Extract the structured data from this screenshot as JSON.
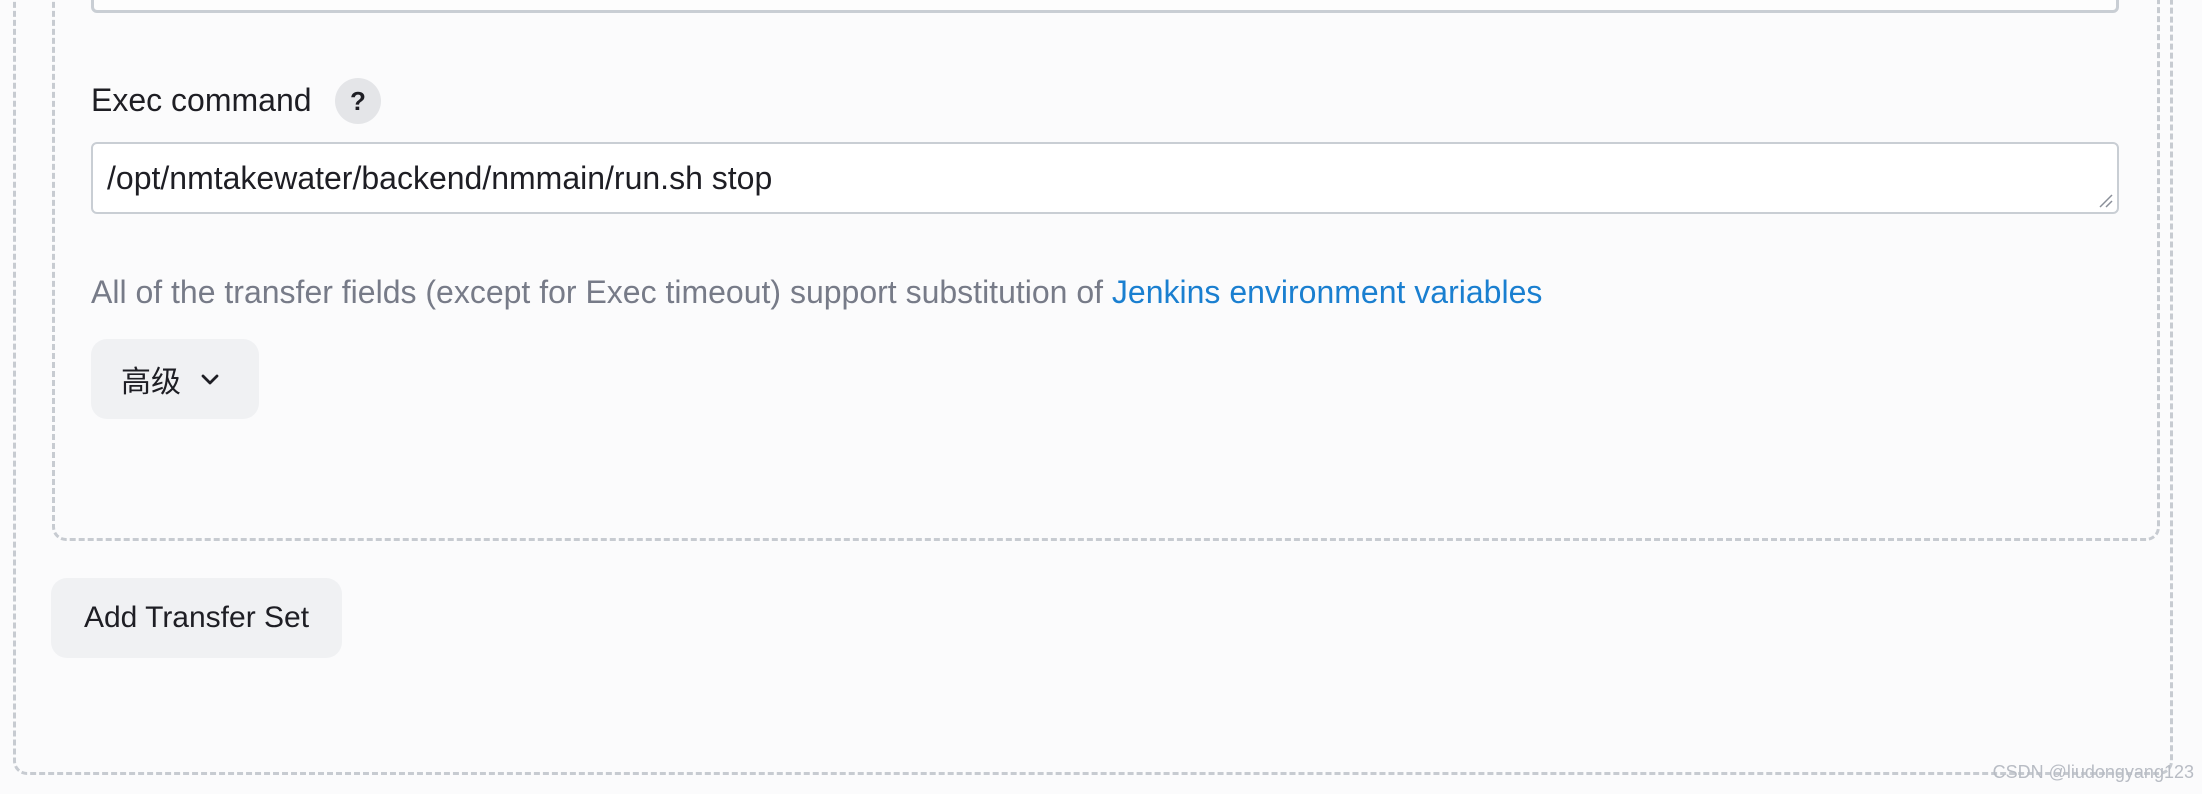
{
  "exec_command": {
    "label": "Exec command",
    "help_icon_glyph": "?",
    "value": "/opt/nmtakewater/backend/nmmain/run.sh stop"
  },
  "info": {
    "text": "All of the transfer fields (except for Exec timeout) support substitution of ",
    "link_text": "Jenkins environment variables"
  },
  "advanced_button": {
    "label": "高级",
    "icon": "chevron-down-icon"
  },
  "add_transfer_set_button": {
    "label": "Add Transfer Set"
  },
  "watermark": {
    "text": "CSDN @liudongyang123"
  },
  "colors": {
    "link": "#1a7fd0",
    "muted_text": "#777b88",
    "button_bg": "#f0f1f3",
    "dashed_border": "#c7cbd1"
  }
}
